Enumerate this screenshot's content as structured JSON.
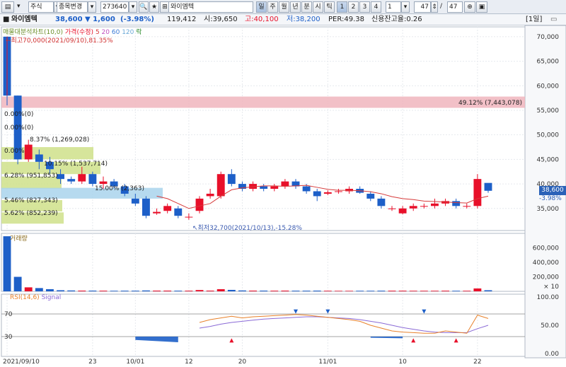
{
  "toolbar": {
    "market": "주식",
    "change_label": "종목변경",
    "code": "273640",
    "name": "와이엠텍",
    "periods": [
      "일",
      "주",
      "월",
      "년",
      "분",
      "시",
      "틱"
    ],
    "active_period": "일",
    "num_buttons": [
      "1",
      "2",
      "3",
      "4"
    ],
    "active_num": "1",
    "unit_value": "1",
    "count_value": "47",
    "count_total": "47"
  },
  "info": {
    "name": "와이엠텍",
    "price": "38,600",
    "change": "▼ 1,600",
    "change_pct": "(-3.98%)",
    "volume": "119,412",
    "open": "시:39,650",
    "high": "고:40,100",
    "low": "저:38,200",
    "per": "PER:49.38",
    "credit": "신용잔고율:0.26",
    "period_tag": "[1일]"
  },
  "price_panel": {
    "legend": [
      "매물대분석차트(10,0)",
      "가격(수정)",
      "5",
      "20",
      "60",
      "120",
      "락"
    ],
    "max_annotation": "←최고70,000(2021/09/10),81.35%",
    "min_annotation": "↖최저32,700(2021/10/13),-15.28%",
    "last_price": "38,600",
    "last_change": "-3.98%",
    "y_ticks": [
      "70,000",
      "65,000",
      "60,000",
      "55,000",
      "50,000",
      "45,000",
      "40,000",
      "35,000"
    ],
    "volume_profile": [
      {
        "label": "0.00%",
        "pct": 0
      },
      {
        "label": "0.00%(0)",
        "pct": 0
      },
      {
        "label": "0.00%(0)",
        "pct": 0
      },
      {
        "label": "8.37% (1,269,028)",
        "pct": 8.37
      },
      {
        "label": "10.15% (1,537,714)",
        "pct": 10.15
      },
      {
        "label": "6.28% (951,853)",
        "pct": 6.28
      },
      {
        "label": "15.00% (2,363)",
        "pct": 15.0
      },
      {
        "label": "5.46% (827,343)",
        "pct": 5.46
      },
      {
        "label": "5.62% (852,239)",
        "pct": 5.62
      },
      {
        "label": "49.12% (7,443,078)",
        "pct": 49.12
      }
    ]
  },
  "volume_panel": {
    "title": "거래량",
    "y_ticks": [
      "600,000",
      "400,000",
      "200,000",
      "× 10"
    ]
  },
  "rsi_panel": {
    "title_rsi": "RSI(14,6)",
    "title_signal": "Signal",
    "levels": [
      "70",
      "30"
    ],
    "y_ticks": [
      "100.00",
      "50.00",
      "0.00"
    ]
  },
  "x_axis": [
    "2021/09/10",
    "23",
    "10/01",
    "12",
    "20",
    "11/01",
    "10",
    "22"
  ],
  "colors": {
    "up": "#e8102a",
    "down": "#1d5fc8",
    "ma": "#d63a3a",
    "rsi": "#e8812a",
    "signal": "#8a6ad6",
    "profile_green": "#cfe08a",
    "profile_blue": "#a9d4ec",
    "profile_pink": "#f0b5bd"
  },
  "chart_data": {
    "type": "candlestick",
    "candles": [
      {
        "o": 70000,
        "c": 58000,
        "h": 70000,
        "l": 56000
      },
      {
        "o": 58000,
        "c": 45000,
        "h": 58000,
        "l": 44000
      },
      {
        "o": 45000,
        "c": 48000,
        "h": 49000,
        "l": 44500
      },
      {
        "o": 46000,
        "c": 44500,
        "h": 47000,
        "l": 43000
      },
      {
        "o": 44500,
        "c": 43000,
        "h": 45500,
        "l": 42000
      },
      {
        "o": 42000,
        "c": 41000,
        "h": 43000,
        "l": 40000
      },
      {
        "o": 41000,
        "c": 40500,
        "h": 41500,
        "l": 40000
      },
      {
        "o": 40500,
        "c": 42000,
        "h": 43500,
        "l": 40000
      },
      {
        "o": 42000,
        "c": 40000,
        "h": 42500,
        "l": 39500
      },
      {
        "o": 40000,
        "c": 40500,
        "h": 41500,
        "l": 39000
      },
      {
        "o": 40500,
        "c": 39500,
        "h": 41000,
        "l": 39000
      },
      {
        "o": 39500,
        "c": 38000,
        "h": 40000,
        "l": 37500
      },
      {
        "o": 37000,
        "c": 36000,
        "h": 38000,
        "l": 35500
      },
      {
        "o": 37000,
        "c": 33500,
        "h": 37500,
        "l": 33000
      },
      {
        "o": 34000,
        "c": 34300,
        "h": 35000,
        "l": 33700
      },
      {
        "o": 34500,
        "c": 35500,
        "h": 36000,
        "l": 34000
      },
      {
        "o": 35000,
        "c": 33500,
        "h": 35500,
        "l": 33000
      },
      {
        "o": 33300,
        "c": 33300,
        "h": 34000,
        "l": 32700
      },
      {
        "o": 34500,
        "c": 37000,
        "h": 37500,
        "l": 34000
      },
      {
        "o": 37500,
        "c": 38000,
        "h": 39000,
        "l": 37000
      },
      {
        "o": 37500,
        "c": 42000,
        "h": 42500,
        "l": 37000
      },
      {
        "o": 42000,
        "c": 40000,
        "h": 43000,
        "l": 39500
      },
      {
        "o": 40000,
        "c": 39000,
        "h": 40500,
        "l": 38500
      },
      {
        "o": 39000,
        "c": 40000,
        "h": 40500,
        "l": 38500
      },
      {
        "o": 39500,
        "c": 39000,
        "h": 40000,
        "l": 38500
      },
      {
        "o": 39000,
        "c": 39500,
        "h": 40000,
        "l": 38500
      },
      {
        "o": 39500,
        "c": 40500,
        "h": 41000,
        "l": 39000
      },
      {
        "o": 40500,
        "c": 39500,
        "h": 41000,
        "l": 39000
      },
      {
        "o": 39500,
        "c": 38500,
        "h": 40000,
        "l": 38000
      },
      {
        "o": 38500,
        "c": 37500,
        "h": 39000,
        "l": 36500
      },
      {
        "o": 38000,
        "c": 38300,
        "h": 38700,
        "l": 37700
      },
      {
        "o": 38500,
        "c": 38500,
        "h": 39000,
        "l": 38000
      },
      {
        "o": 38500,
        "c": 39000,
        "h": 39500,
        "l": 38000
      },
      {
        "o": 39000,
        "c": 38200,
        "h": 39500,
        "l": 38000
      },
      {
        "o": 38000,
        "c": 37000,
        "h": 38500,
        "l": 36500
      },
      {
        "o": 37000,
        "c": 35500,
        "h": 37500,
        "l": 35000
      },
      {
        "o": 35000,
        "c": 35000,
        "h": 35500,
        "l": 34500
      },
      {
        "o": 34000,
        "c": 35000,
        "h": 35500,
        "l": 33800
      },
      {
        "o": 35000,
        "c": 35500,
        "h": 36000,
        "l": 34500
      },
      {
        "o": 35500,
        "c": 35500,
        "h": 36000,
        "l": 35000
      },
      {
        "o": 35500,
        "c": 36000,
        "h": 37000,
        "l": 35000
      },
      {
        "o": 36000,
        "c": 36500,
        "h": 37000,
        "l": 35500
      },
      {
        "o": 36500,
        "c": 35500,
        "h": 37000,
        "l": 35000
      },
      {
        "o": 35500,
        "c": 35500,
        "h": 36000,
        "l": 35000
      },
      {
        "o": 35500,
        "c": 41000,
        "h": 42000,
        "l": 35000
      },
      {
        "o": 40200,
        "c": 38600,
        "h": 40100,
        "l": 38200
      }
    ],
    "ma5": [
      null,
      null,
      null,
      null,
      null,
      null,
      null,
      null,
      null,
      null,
      null,
      null,
      null,
      null,
      37500,
      37000,
      36000,
      35000,
      35500,
      36000,
      37500,
      38800,
      39200,
      39400,
      39600,
      39600,
      39500,
      39600,
      39700,
      39300,
      38900,
      38700,
      38700,
      38600,
      38400,
      38000,
      37400,
      37000,
      36800,
      36500,
      36400,
      36300,
      36200,
      36100,
      37000,
      37500
    ],
    "volume_bars": [
      760000,
      200000,
      55000,
      45000,
      30000,
      15000,
      12000,
      10000,
      10000,
      9000,
      8000,
      9000,
      9000,
      12000,
      10000,
      10000,
      9000,
      9000,
      18000,
      10000,
      30000,
      20000,
      12000,
      10000,
      10000,
      9000,
      10000,
      9000,
      9000,
      10000,
      8000,
      7000,
      7000,
      8000,
      8000,
      9000,
      9000,
      9000,
      8000,
      8000,
      8000,
      9000,
      8000,
      8000,
      40000,
      15000
    ],
    "rsi": [
      null,
      null,
      null,
      null,
      null,
      null,
      null,
      null,
      null,
      null,
      null,
      null,
      null,
      null,
      null,
      null,
      null,
      null,
      55,
      60,
      63,
      66,
      63,
      65,
      66,
      67,
      68,
      69,
      68,
      66,
      64,
      62,
      60,
      57,
      50,
      45,
      40,
      38,
      37,
      36,
      36,
      40,
      38,
      36,
      68,
      62
    ],
    "signal": [
      null,
      null,
      null,
      null,
      null,
      null,
      null,
      null,
      null,
      null,
      null,
      null,
      null,
      null,
      null,
      null,
      null,
      null,
      45,
      48,
      52,
      55,
      57,
      59,
      61,
      62,
      63,
      64,
      65,
      65,
      64,
      63,
      62,
      60,
      57,
      54,
      50,
      46,
      43,
      40,
      38,
      37,
      37,
      37,
      44,
      50
    ]
  }
}
